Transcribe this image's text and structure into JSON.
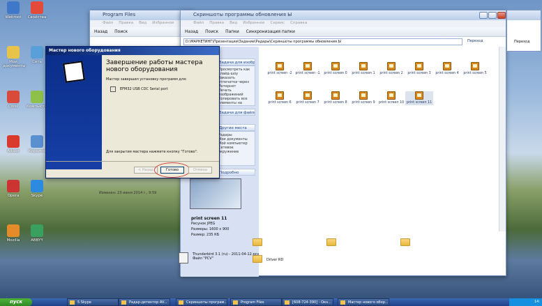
{
  "desktop_icons": [
    {
      "label": "Webroot"
    },
    {
      "label": "Свойства"
    },
    {
      "label": "Мои документы"
    },
    {
      "label": "Сеть"
    },
    {
      "label": "Corel"
    },
    {
      "label": "Компьютер"
    },
    {
      "label": "Adobe"
    },
    {
      "label": "Корзина"
    },
    {
      "label": "Opera"
    },
    {
      "label": "Skype"
    },
    {
      "label": "Mozilla"
    },
    {
      "label": "ABBYY"
    }
  ],
  "program_files_window": {
    "title": "Program Files",
    "menu": [
      "Файл",
      "Правка",
      "Вид",
      "Избранное",
      "Сервис",
      "Справка"
    ],
    "back_label": "Назад",
    "search_label": "Поиск"
  },
  "main_window": {
    "title": "Скриншоты программы обновления Ы",
    "menu": [
      "Файл",
      "Правка",
      "Вид",
      "Избранное",
      "Сервис",
      "Справка"
    ],
    "back_label": "Назад",
    "search_label": "Поиск",
    "folders_label": "Папки",
    "sync_label": "Синхронизация папки",
    "address": "D:\\МАРКЕТИНГ\\Презентации\\Задание\\Радары\\Скриншоты программы обновления Ы",
    "go_label": "Переход",
    "files": [
      "print screen -2",
      "print screen -1",
      "print screen 0",
      "print screen 1",
      "print screen 2",
      "print screen 3",
      "print screen 4",
      "print screen 5",
      "print screen 6",
      "print screen 7",
      "print screen 8",
      "print screen 9",
      "print screen 10",
      "print screen 11"
    ]
  },
  "wizard": {
    "title": "Мастер нового оборудования",
    "heading": "Завершение работы мастера нового оборудования",
    "installed_text": "Мастер завершил установку программ для:",
    "device": "EFM32 USB CDC Serial port",
    "close_hint": "Для закрытия мастера нажмите кнопку \"Готово\".",
    "back_button": "< Назад",
    "finish_button": "Готово",
    "cancel_button": "Отмена"
  },
  "side_panel": {
    "task_head": "Задачи для изображений",
    "tasks_text": "Просмотреть как слайд-шоу\nЗаказать отпечатки через Интернет\nПечать изображений\nКопировать все элементы на компакт-диск",
    "folders_head": "Задачи для файлов и папок",
    "other_head": "Другие места",
    "other_text": "Радары\nМои документы\nМой компьютер\nСетевое окружение",
    "details_head": "Подробно",
    "modified": "Изменен: 23 июня 2014 г., 9:59"
  },
  "details": {
    "name": "print screen 11",
    "type": "Рисунок JPEG",
    "size_px": "Размеры: 1600 x 900",
    "file_size": "Размер: 235 КБ"
  },
  "lower_files": [
    {
      "label": "Thunderbird 3.1 (ru) - 2011-04-12.pcv\nФайл \"PCV\""
    },
    {
      "label": "Driver RD"
    }
  ],
  "taskbar": {
    "start": "пуск",
    "items": [
      "5 Skype",
      "Радар-детектор AV...",
      "Скриншоты програм...",
      "Program Files",
      "[608-724-390] - Окн...",
      "Мастер нового обор..."
    ],
    "clock": "14:"
  },
  "colors": {
    "taskbar": "#2b4c84",
    "start": "#3c9a2c",
    "finish_ring": "#d23c3c"
  }
}
